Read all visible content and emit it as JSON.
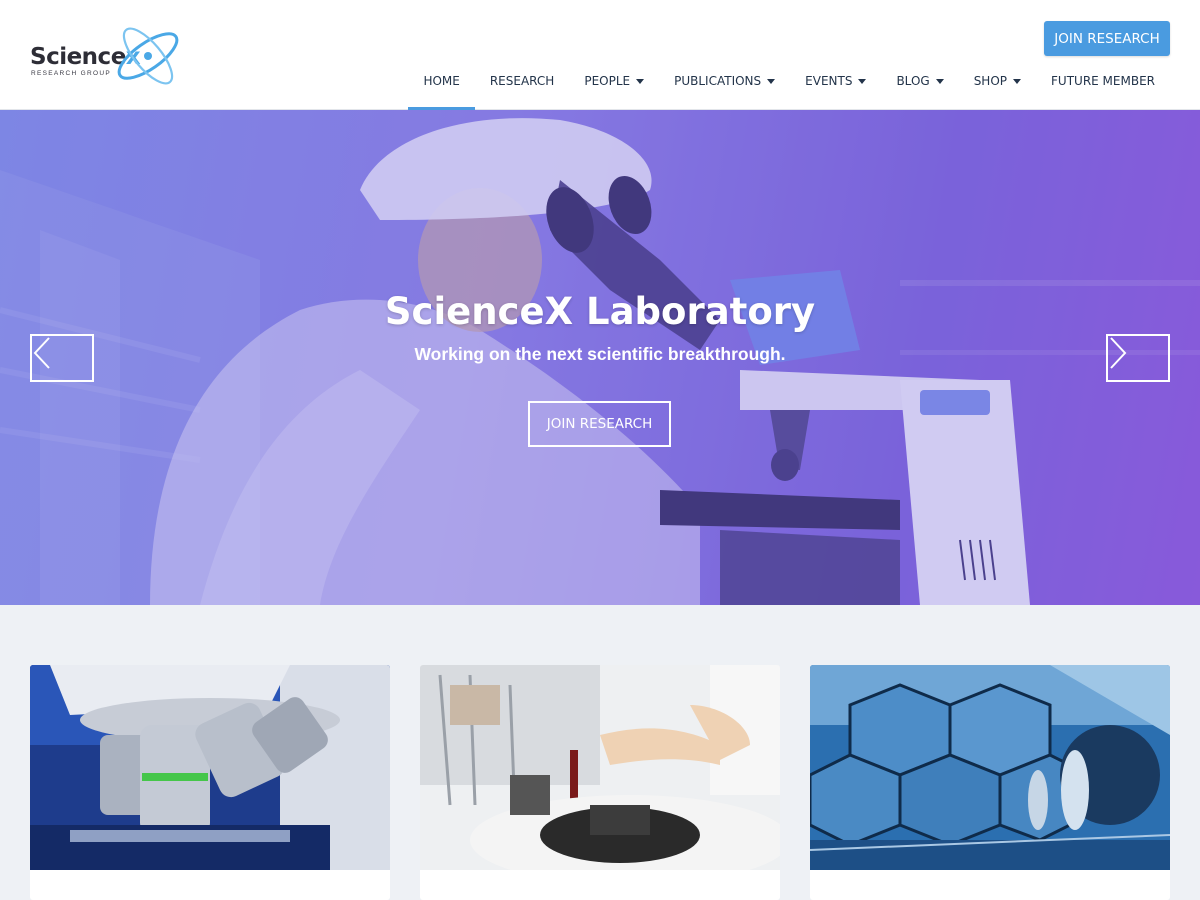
{
  "brand": {
    "name_main": "Science",
    "name_x": "x",
    "tagline": "RESEARCH GROUP",
    "accent": "#4a9be0"
  },
  "header": {
    "cta_label": "JOIN RESEARCH"
  },
  "nav": [
    {
      "label": "HOME",
      "active": true,
      "dropdown": false
    },
    {
      "label": "RESEARCH",
      "active": false,
      "dropdown": false
    },
    {
      "label": "PEOPLE",
      "active": false,
      "dropdown": true
    },
    {
      "label": "PUBLICATIONS",
      "active": false,
      "dropdown": true
    },
    {
      "label": "EVENTS",
      "active": false,
      "dropdown": true
    },
    {
      "label": "BLOG",
      "active": false,
      "dropdown": true
    },
    {
      "label": "SHOP",
      "active": false,
      "dropdown": true
    },
    {
      "label": "FUTURE MEMBER",
      "active": false,
      "dropdown": false
    }
  ],
  "hero": {
    "title": "ScienceX Laboratory",
    "subtitle": "Working on the next scientific breakthrough.",
    "button_label": "JOIN RESEARCH",
    "overlay_colors": [
      "#7f8fe6",
      "#8e52d8"
    ]
  },
  "cards": [
    {
      "image": "microscope-objectives"
    },
    {
      "image": "lab-centrifuge-samples"
    },
    {
      "image": "hexagonal-telescope-mirrors"
    }
  ]
}
